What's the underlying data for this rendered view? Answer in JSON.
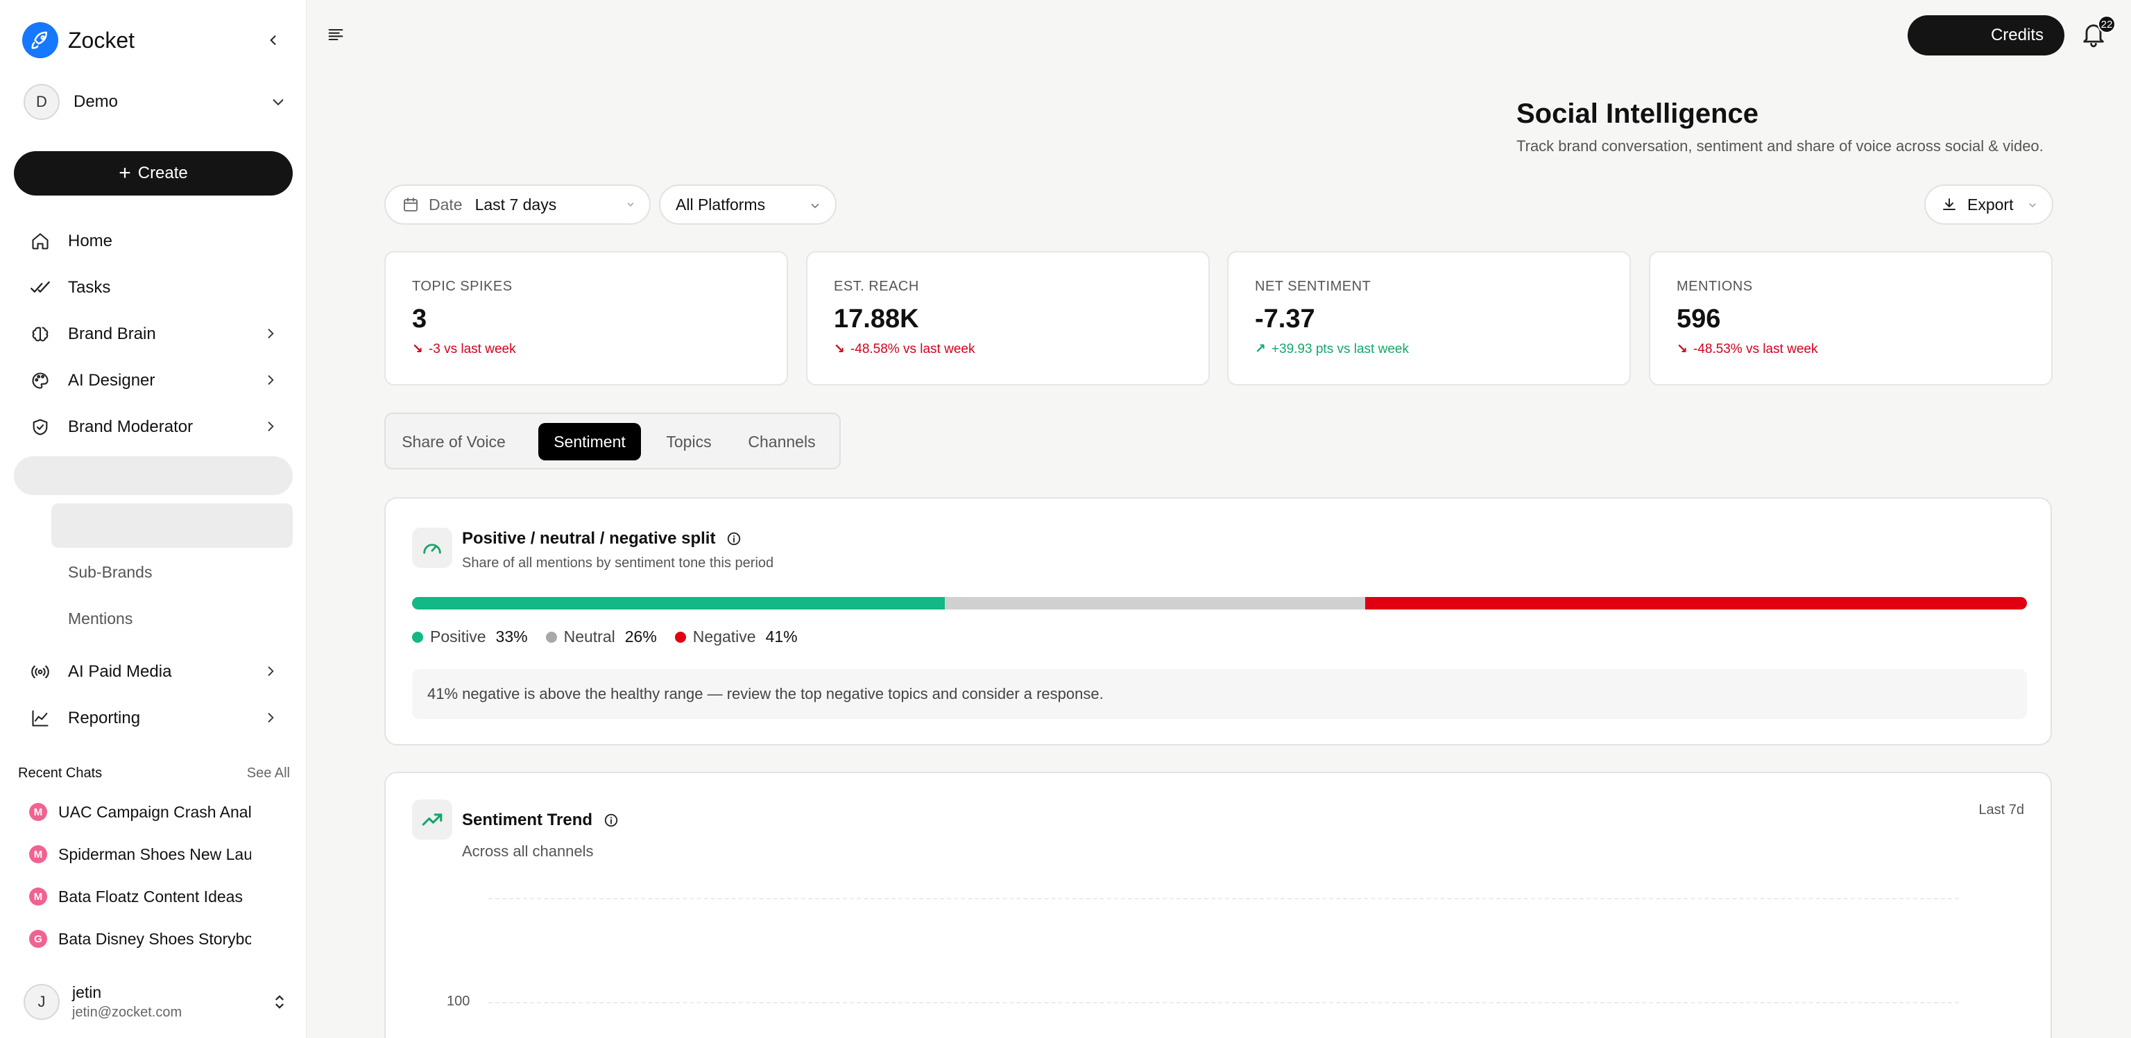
{
  "app": {
    "brand": "Zocket",
    "workspace": {
      "initial": "D",
      "name": "Demo"
    },
    "create_label": "Create",
    "nav": [
      {
        "label": "Home",
        "icon": "home-icon"
      },
      {
        "label": "Tasks",
        "icon": "tasks-check-icon"
      },
      {
        "label": "Brand Brain",
        "icon": "brain-icon"
      },
      {
        "label": "AI Designer",
        "icon": "palette-icon"
      },
      {
        "label": "Brand Moderator",
        "icon": "shield-check-icon"
      }
    ],
    "sub_items": [
      "Sub-Brands",
      "Mentions"
    ],
    "nav_more": [
      {
        "label": "AI Paid Media",
        "icon": "broadcast-icon"
      },
      {
        "label": "Reporting",
        "icon": "line-chart-icon"
      }
    ],
    "recent": {
      "title": "Recent Chats",
      "see_all": "See All",
      "items": [
        {
          "badge": "M",
          "title": "UAC Campaign Crash Analysis"
        },
        {
          "badge": "M",
          "title": "Spiderman Shoes New Launch"
        },
        {
          "badge": "M",
          "title": "Bata Floatz Content Ideas"
        },
        {
          "badge": "G",
          "title": "Bata Disney Shoes Storyboard"
        }
      ]
    },
    "user": {
      "initial": "J",
      "name": "jetin",
      "email": "jetin@zocket.com"
    }
  },
  "topbar": {
    "credits_label": "Credits",
    "notification_count": "22"
  },
  "header": {
    "title": "Social Intelligence",
    "subtitle": "Track brand conversation, sentiment and share of voice across social & video."
  },
  "filters": {
    "date_label": "Date",
    "date_value": "Last 7 days",
    "platform_value": "All Platforms",
    "export_label": "Export"
  },
  "stats": [
    {
      "label": "TOPIC SPIKES",
      "value": "3",
      "delta": "-3 vs last week",
      "direction": "down",
      "color": "#d3001b"
    },
    {
      "label": "EST. REACH",
      "value": "17.88K",
      "delta": "-48.58% vs last week",
      "direction": "down",
      "color": "#d3001b"
    },
    {
      "label": "NET SENTIMENT",
      "value": "-7.37",
      "delta": "+39.93 pts vs last week",
      "direction": "up",
      "color": "#12a86b"
    },
    {
      "label": "MENTIONS",
      "value": "596",
      "delta": "-48.53% vs last week",
      "direction": "down",
      "color": "#d3001b"
    }
  ],
  "tabs": [
    {
      "label": "Share of Voice",
      "active": false
    },
    {
      "label": "Sentiment",
      "active": true
    },
    {
      "label": "Topics",
      "active": false
    },
    {
      "label": "Channels",
      "active": false
    }
  ],
  "split_card": {
    "title": "Positive / neutral / negative split",
    "subtitle": "Share of all mentions by sentiment tone this period",
    "segments": [
      {
        "name": "Positive",
        "value": 33,
        "display": "33%",
        "color": "#12b886"
      },
      {
        "name": "Neutral",
        "value": 26,
        "display": "26%",
        "color": "#d0d0d0"
      },
      {
        "name": "Negative",
        "value": 41,
        "display": "41%",
        "color": "#e00012"
      }
    ],
    "note": "41% negative is above the healthy range — review the top negative topics and consider a response."
  },
  "trend_card": {
    "title": "Sentiment Trend",
    "subtitle": "Across all channels",
    "range": "Last 7d",
    "y_tick": "100"
  }
}
